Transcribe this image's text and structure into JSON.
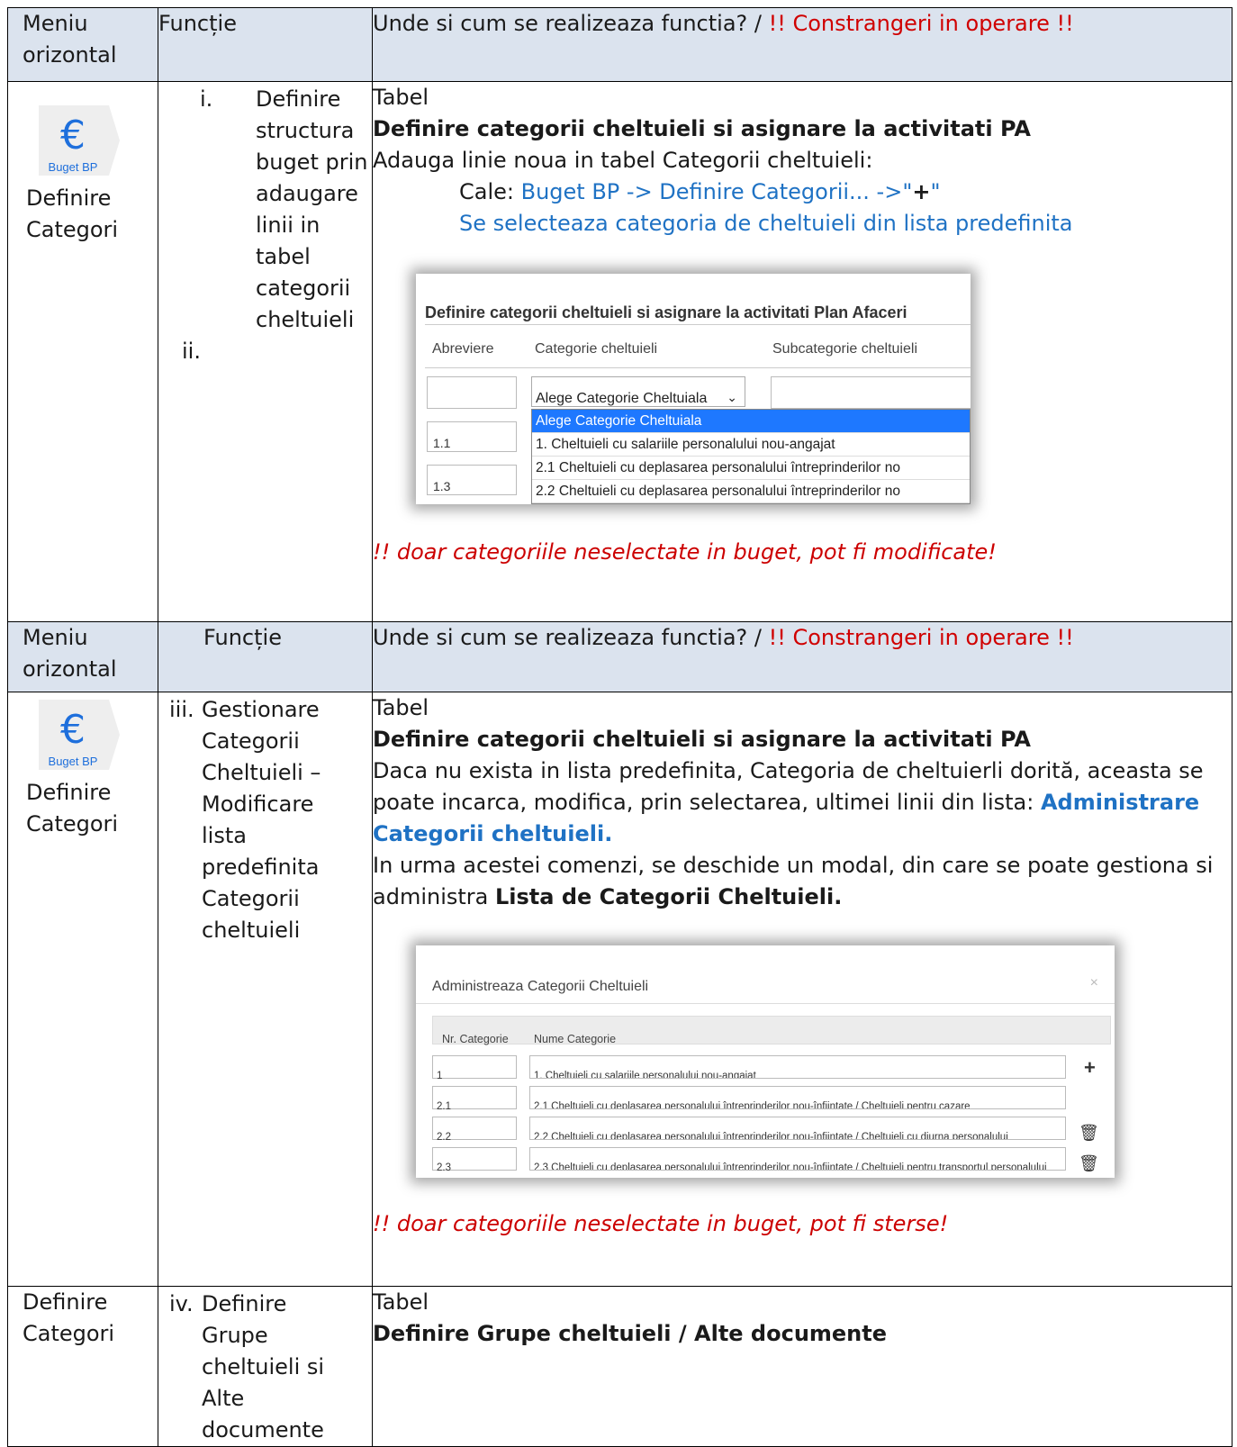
{
  "header": {
    "col1": "Meniu orizontal",
    "col2": "Funcție",
    "col3_text": "Unde si cum se realizeaza functia?  / ",
    "col3_warning": " !! Constrangeri in operare !!"
  },
  "icon": {
    "label": "Buget BP",
    "symbol": "€"
  },
  "row1": {
    "menu_label": "Definire Categori",
    "functions": [
      {
        "num": "i.",
        "text": "Definire structura buget prin adaugare linii in tabel categorii cheltuieli"
      },
      {
        "num": "ii.",
        "text": ""
      }
    ],
    "tabel": "Tabel",
    "heading": "Definire categorii cheltuieli si asignare la activitati PA",
    "intro": "Adauga  linie noua in tabel Categorii cheltuieli:",
    "cale_label": "Cale: ",
    "cale_path": "Buget BP -> Definire Categorii...  ->\"",
    "cale_plus": "+",
    "cale_end": "\"",
    "select_line": "Se selecteaza categoria de cheltuieli din lista predefinita",
    "note": "!!     doar categoriile neselectate in buget, pot fi modificate!"
  },
  "shot1": {
    "title": "Definire categorii cheltuieli si asignare la activitati Plan Afaceri",
    "col_abreviere": "Abreviere",
    "col_categorie": "Categorie cheltuieli",
    "col_subcategorie": "Subcategorie cheltuieli",
    "select_value": "Alege Categorie Cheltuiala",
    "chevron": "⌄",
    "row_values": [
      "1.1",
      "1.3"
    ],
    "options": [
      "Alege Categorie Cheltuiala",
      "1. Cheltuieli cu salariile personalului nou-angajat",
      "2.1 Cheltuieli cu deplasarea personalului întreprinderilor no",
      "2.2 Cheltuieli cu deplasarea personalului întreprinderilor no"
    ]
  },
  "header2": {
    "col1": "Meniu orizontal",
    "col2": "Funcție",
    "col3_text": "Unde si cum se realizeaza functia?  / ",
    "col3_warning": " !! Constrangeri in operare !!"
  },
  "row2": {
    "menu_label": "Definire Categori",
    "function_num": "iii.",
    "function_text": "Gestionare Categorii Cheltuieli – Modificare lista predefinita Categorii cheltuieli",
    "tabel": "Tabel",
    "heading": "Definire categorii cheltuieli si asignare la activitati PA",
    "p1_text": "Daca nu exista in lista predefinita, Categoria de cheltuierli dorită, aceasta se poate incarca, modifica, prin selectarea, ultimei linii din lista: ",
    "p1_link": " Administrare Categorii cheltuieli.",
    "p2_text": "In urma acestei comenzi, se deschide un modal, din care se poate gestiona si administra ",
    "p2_bold": "Lista de Categorii Cheltuieli.",
    "note": "!!   doar categoriile neselectate in buget, pot fi sterse!"
  },
  "shot2": {
    "modal_title": "Administreaza Categorii Cheltuieli",
    "close": "×",
    "col_nr": "Nr. Categorie",
    "col_nume": "Nume Categorie",
    "rows": [
      {
        "nr": "1",
        "name": "1. Cheltuieli cu salariile personalului nou-angajat",
        "action": "+"
      },
      {
        "nr": "2.1",
        "name": "2.1 Cheltuieli cu deplasarea personalului întreprinderilor nou-înființate / Cheltuieli pentru cazare",
        "action": ""
      },
      {
        "nr": "2.2",
        "name": "2.2 Cheltuieli cu deplasarea personalului întreprinderilor nou-înființate / Cheltuieli cu diurna personalului",
        "action": "🗑"
      },
      {
        "nr": "2.3",
        "name": "2.3 Cheltuieli cu deplasarea personalului întreprinderilor nou-înființate / Cheltuieli pentru transportul personalului",
        "action": "🗑"
      }
    ]
  },
  "row3": {
    "menu_label": "Definire Categori",
    "function_num": "iv.",
    "function_text": "Definire Grupe cheltuieli si Alte documente",
    "tabel": "Tabel",
    "heading": "Definire Grupe cheltuieli / Alte documente"
  }
}
